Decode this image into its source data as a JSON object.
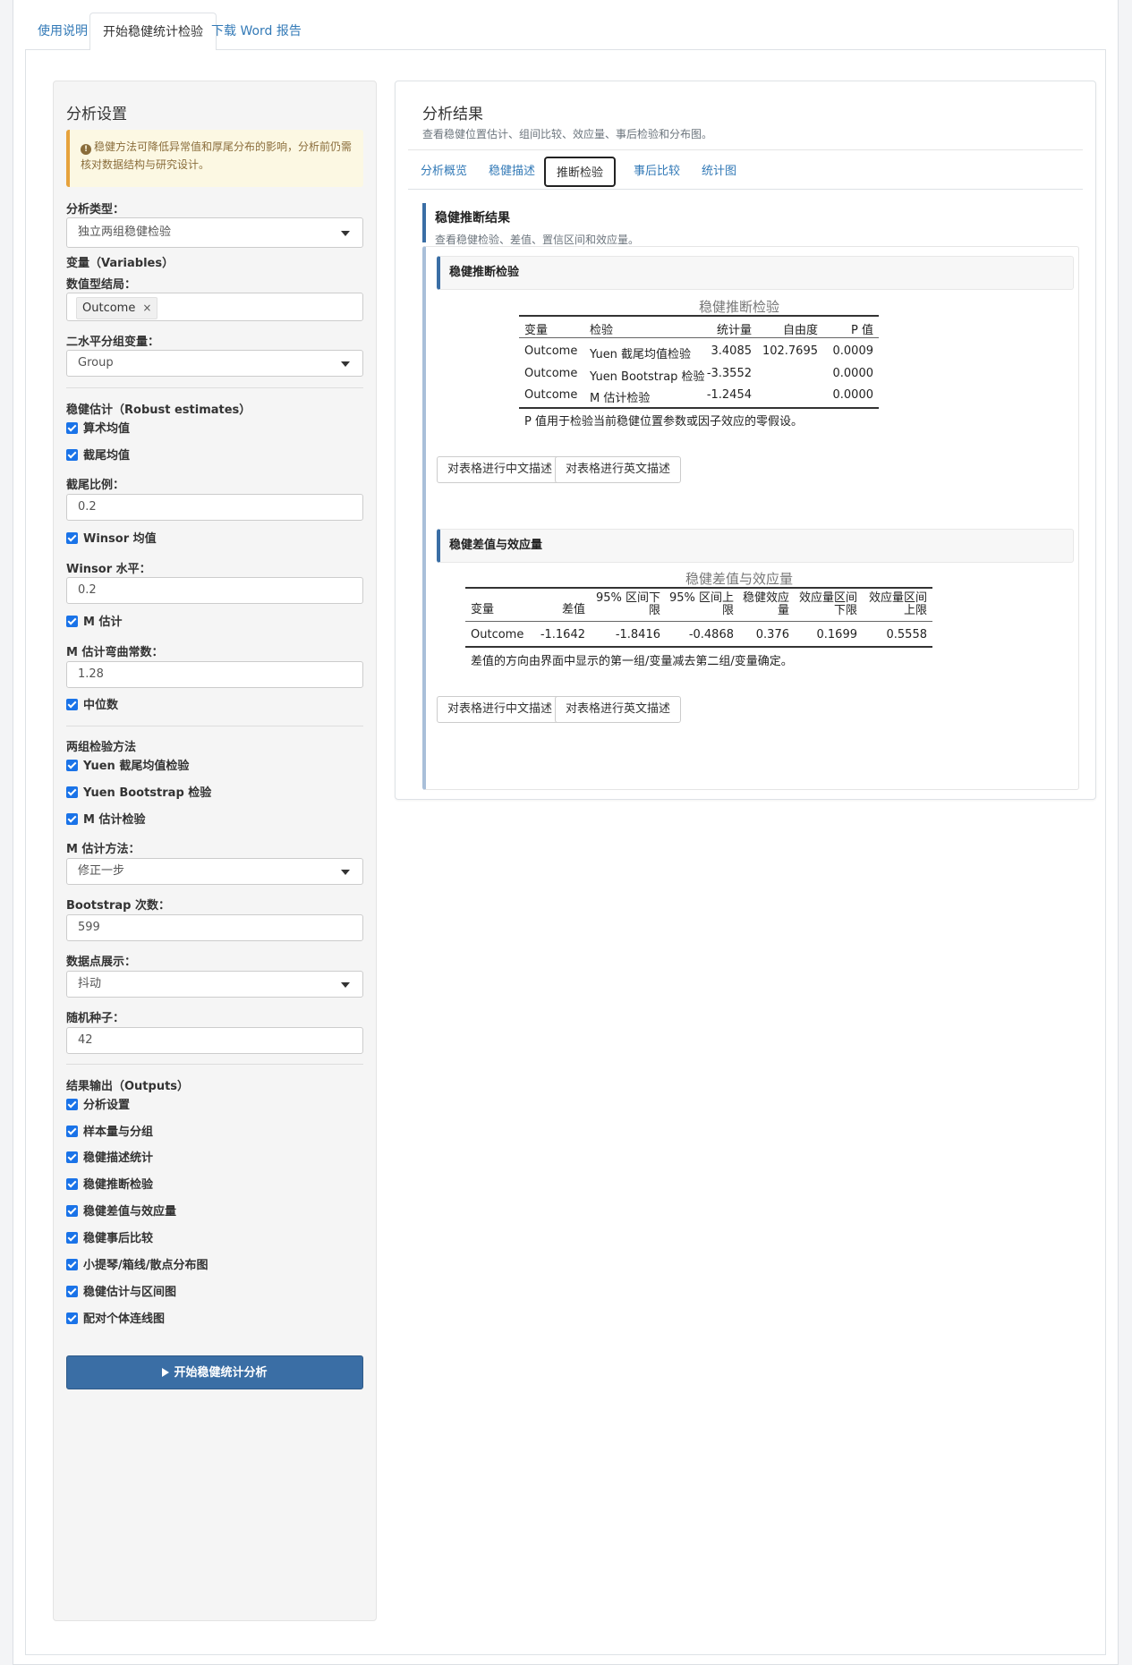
{
  "nav": {
    "tabs": [
      {
        "label": "使用说明"
      },
      {
        "label": "开始稳健统计检验"
      },
      {
        "label": "下载 Word 报告"
      }
    ]
  },
  "sidebar": {
    "title": "分析设置",
    "alert": "稳健方法可降低异常值和厚尾分布的影响，分析前仍需核对数据结构与研究设计。",
    "analysis_type_label": "分析类型：",
    "analysis_type_value": "独立两组稳健检验",
    "variables_section": "变量（Variables）",
    "numeric_label": "数值型结局：",
    "numeric_chip": "Outcome",
    "chip_remove": "×",
    "group_label": "二水平分组变量：",
    "group_value": "Group",
    "robust_section": "稳健估计（Robust estimates）",
    "cb_mean": "算术均值",
    "cb_trimmed": "截尾均值",
    "trim_label": "截尾比例：",
    "trim_value": "0.2",
    "cb_winsor": "Winsor 均值",
    "winsor_label": "Winsor 水平：",
    "winsor_value": "0.2",
    "cb_m": "M 估计",
    "m_const_label": "M 估计弯曲常数：",
    "m_const_value": "1.28",
    "cb_median": "中位数",
    "test_section": "两组检验方法",
    "cb_yuen": "Yuen 截尾均值检验",
    "cb_yuen_boot": "Yuen Bootstrap 检验",
    "cb_m_test": "M 估计检验",
    "m_method_label": "M 估计方法：",
    "m_method_value": "修正一步",
    "boot_label": "Bootstrap 次数：",
    "boot_value": "599",
    "points_label": "数据点展示：",
    "points_value": "抖动",
    "seed_label": "随机种子：",
    "seed_value": "42",
    "output_section": "结果输出（Outputs）",
    "outputs": [
      "分析设置",
      "样本量与分组",
      "稳健描述统计",
      "稳健推断检验",
      "稳健差值与效应量",
      "稳健事后比较",
      "小提琴/箱线/散点分布图",
      "稳健估计与区间图",
      "配对个体连线图"
    ],
    "run_button": "开始稳健统计分析"
  },
  "results": {
    "title": "分析结果",
    "subtitle": "查看稳健位置估计、组间比较、效应量、事后检验和分布图。",
    "tabs": [
      "分析概览",
      "稳健描述",
      "推断检验",
      "事后比较",
      "统计图"
    ],
    "section_title": "稳健推断结果",
    "section_sub": "查看稳健检验、差值、置信区间和效应量。",
    "card1": {
      "heading": "稳健推断检验",
      "caption": "稳健推断检验",
      "headers": [
        "变量",
        "检验",
        "统计量",
        "自由度",
        "P 值"
      ],
      "rows": [
        [
          "Outcome",
          "Yuen 截尾均值检验",
          "3.4085",
          "102.7695",
          "0.0009"
        ],
        [
          "Outcome",
          "Yuen Bootstrap 检验",
          "-3.3552",
          "",
          "0.0000"
        ],
        [
          "Outcome",
          "M 估计检验",
          "-1.2454",
          "",
          "0.0000"
        ]
      ],
      "note": "P 值用于检验当前稳健位置参数或因子效应的零假设。"
    },
    "card2": {
      "heading": "稳健差值与效应量",
      "caption": "稳健差值与效应量",
      "headers": [
        [
          "变量"
        ],
        [
          "差值"
        ],
        [
          "95% 区间下",
          "限"
        ],
        [
          "95% 区间上",
          "限"
        ],
        [
          "稳健效应",
          "量"
        ],
        [
          "效应量区间",
          "下限"
        ],
        [
          "效应量区间",
          "上限"
        ]
      ],
      "row": [
        "Outcome",
        "-1.1642",
        "-1.8416",
        "-0.4868",
        "0.376",
        "0.1699",
        "0.5558"
      ],
      "note": "差值的方向由界面中显示的第一组/变量减去第二组/变量确定。"
    },
    "btn_cn": "对表格进行中文描述",
    "btn_en": "对表格进行英文描述"
  }
}
